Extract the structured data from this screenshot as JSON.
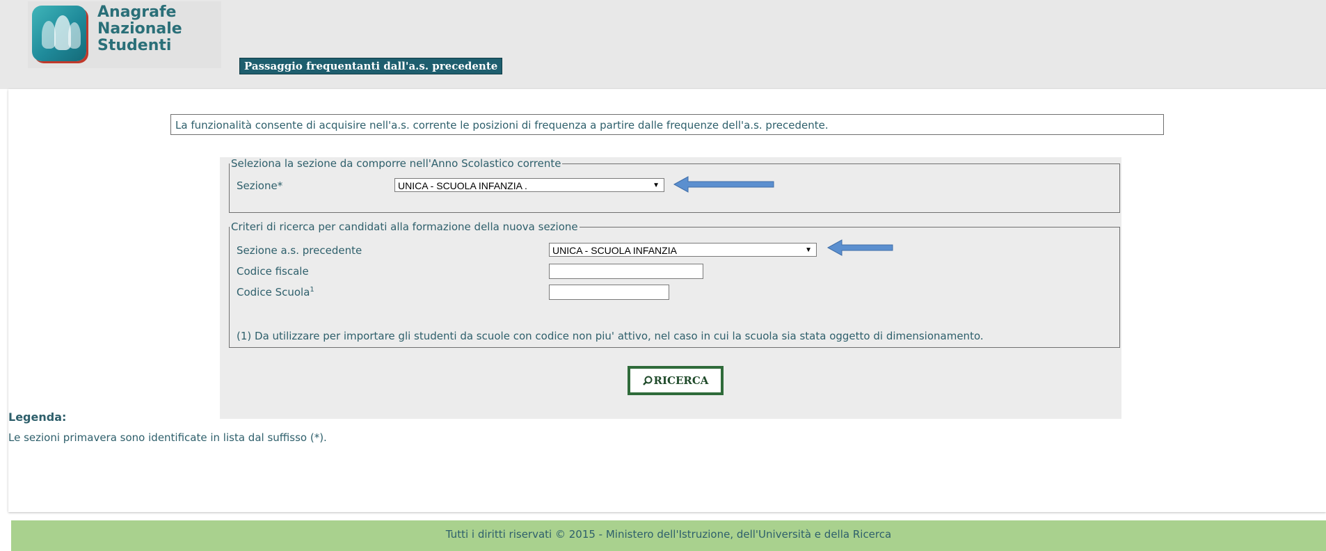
{
  "app": {
    "logo_lines": [
      "Anagrafe",
      "Nazionale",
      "Studenti"
    ],
    "page_title": "Passaggio frequentanti dall'a.s. precedente"
  },
  "info": {
    "text": "La funzionalità consente di acquisire nell'a.s. corrente le posizioni di frequenza a partire dalle frequenze dell'a.s. precedente."
  },
  "section_select": {
    "legend": "Seleziona la sezione da comporre nell'Anno Scolastico corrente",
    "label": "Sezione*",
    "value": "UNICA - SCUOLA INFANZIA ."
  },
  "criteria": {
    "legend": "Criteri di ricerca per candidati alla formazione della nuova sezione",
    "prev_section_label": "Sezione a.s. precedente",
    "prev_section_value": "UNICA - SCUOLA INFANZIA",
    "fiscal_code_label": "Codice fiscale",
    "fiscal_code_value": "",
    "school_code_label": "Codice Scuola",
    "school_code_sup": "1",
    "school_code_value": "",
    "footnote": "(1) Da utilizzare per importare gli studenti da scuole con codice non piu' attivo, nel caso in cui la scuola sia stata oggetto di dimensionamento."
  },
  "search_button": {
    "label": "RICERCA"
  },
  "legend": {
    "title": "Legenda:",
    "text": "Le sezioni primavera sono identificate in lista dal suffisso (*)."
  },
  "footer": {
    "text": "Tutti i diritti riservati © 2015 -  Ministero dell'Istruzione, dell'Università e della Ricerca"
  },
  "colors": {
    "accent": "#1e5e6e",
    "footer_bg": "#a9d18e",
    "annotation_arrow": "#5b8fcf"
  },
  "icons": [
    "search-icon",
    "dropdown-arrow-icon",
    "logo-icon",
    "annotation-arrow-icon"
  ]
}
